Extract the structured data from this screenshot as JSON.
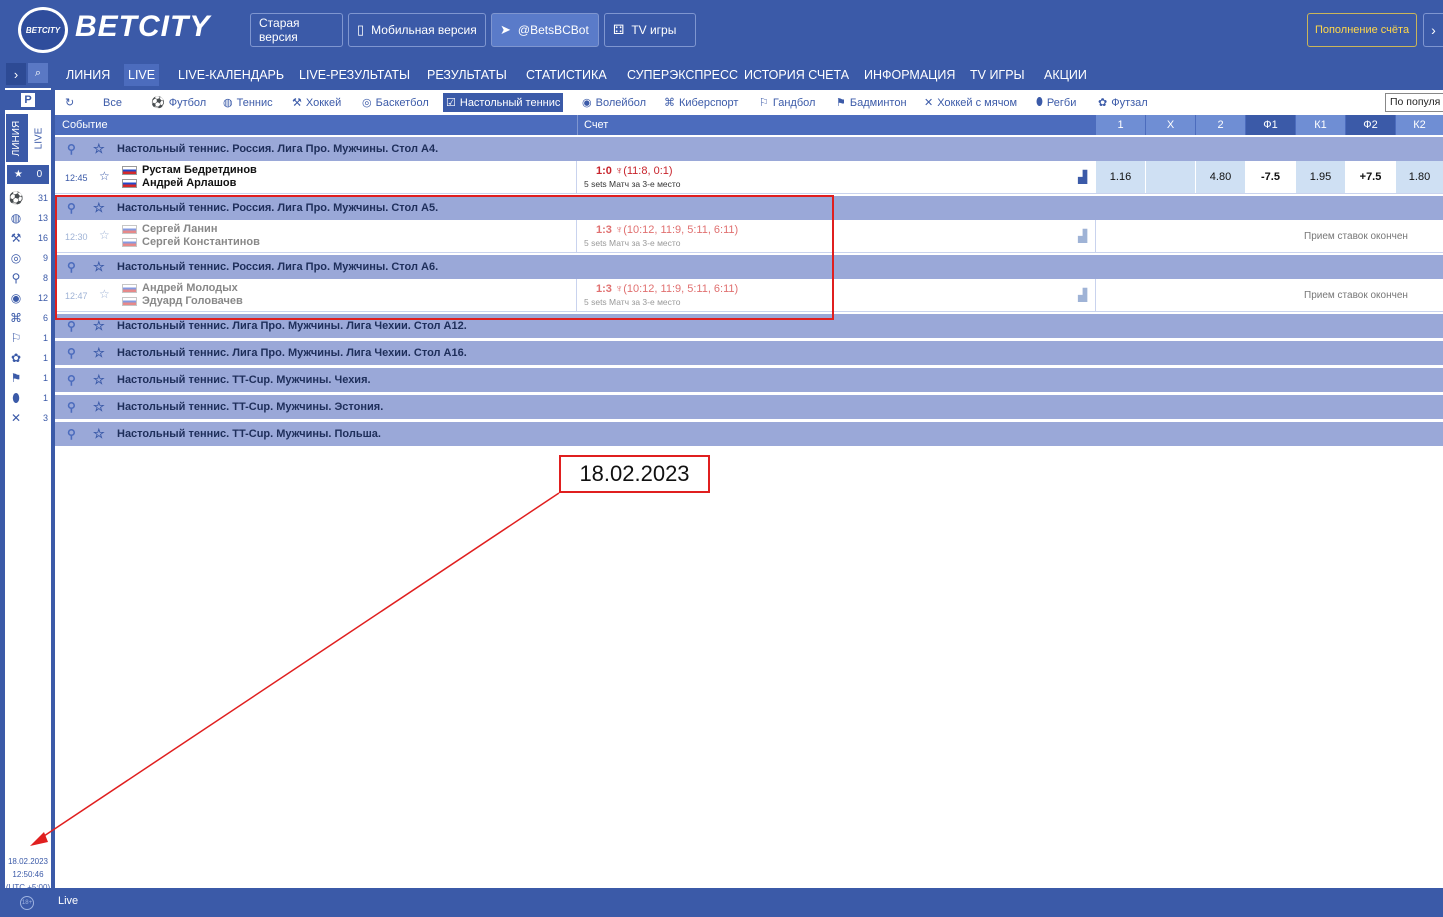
{
  "header": {
    "logo_badge": "BETCITY",
    "logo_text": "BETCITY",
    "buttons": [
      {
        "label": "Старая версия"
      },
      {
        "label": "Мобильная версия"
      },
      {
        "label": "@BetsBCBot"
      },
      {
        "label": "TV игры"
      }
    ],
    "topup_label": "Пополнение счёта",
    "topup_arrow": "›"
  },
  "nav": {
    "items": [
      {
        "label": "ЛИНИЯ"
      },
      {
        "label": "LIVE"
      },
      {
        "label": "LIVE-КАЛЕНДАРЬ"
      },
      {
        "label": "LIVE-РЕЗУЛЬТАТЫ"
      },
      {
        "label": "РЕЗУЛЬТАТЫ"
      },
      {
        "label": "СТАТИСТИКА"
      },
      {
        "label": "СУПЕРЭКСПРЕСС"
      },
      {
        "label": "ИСТОРИЯ СЧЕТА"
      },
      {
        "label": "ИНФОРМАЦИЯ"
      },
      {
        "label": "TV ИГРЫ"
      },
      {
        "label": "АКЦИИ"
      }
    ],
    "active": "LIVE"
  },
  "sidebar": {
    "park_label": "P",
    "tab_line": "ЛИНИЯ",
    "tab_live": "LIVE",
    "favorites_count": "0",
    "sports": [
      {
        "icon": "soccer-icon",
        "count": "31"
      },
      {
        "icon": "tennis-icon",
        "count": "13"
      },
      {
        "icon": "hockey-icon",
        "count": "16"
      },
      {
        "icon": "basketball-icon",
        "count": "9"
      },
      {
        "icon": "table-tennis-icon",
        "count": "8"
      },
      {
        "icon": "volleyball-icon",
        "count": "12"
      },
      {
        "icon": "esports-icon",
        "count": "6"
      },
      {
        "icon": "handball-icon",
        "count": "1"
      },
      {
        "icon": "futsal-icon",
        "count": "1"
      },
      {
        "icon": "badminton-icon",
        "count": "1"
      },
      {
        "icon": "rugby-icon",
        "count": "1"
      },
      {
        "icon": "bandy-icon",
        "count": "3"
      }
    ],
    "date": "18.02.2023",
    "time": "12:50:46",
    "tz": "(UTC +5:00)",
    "age": "18+"
  },
  "filters": {
    "tabs": [
      {
        "label": "Все",
        "icon": "refresh-icon"
      },
      {
        "label": "Футбол",
        "icon": "soccer-icon"
      },
      {
        "label": "Теннис",
        "icon": "tennis-icon"
      },
      {
        "label": "Хоккей",
        "icon": "hockey-icon"
      },
      {
        "label": "Баскетбол",
        "icon": "basketball-icon"
      },
      {
        "label": "Настольный теннис",
        "icon": "checkbox-icon"
      },
      {
        "label": "Волейбол",
        "icon": "volleyball-icon"
      },
      {
        "label": "Киберспорт",
        "icon": "esports-icon"
      },
      {
        "label": "Гандбол",
        "icon": "handball-icon"
      },
      {
        "label": "Бадминтон",
        "icon": "badminton-icon"
      },
      {
        "label": "Хоккей с мячом",
        "icon": "bandy-icon"
      },
      {
        "label": "Регби",
        "icon": "rugby-icon"
      },
      {
        "label": "Футзал",
        "icon": "futsal-icon"
      }
    ],
    "active": "Настольный теннис",
    "sort_value": "По популя"
  },
  "table": {
    "col_event": "Событие",
    "col_score": "Счет",
    "odds_cols": [
      "1",
      "X",
      "2",
      "Ф1",
      "К1",
      "Ф2",
      "К2"
    ]
  },
  "leagues": [
    "Настольный теннис. Россия. Лига Про. Мужчины. Стол А4.",
    "Настольный теннис. Россия. Лига Про. Мужчины. Стол А5.",
    "Настольный теннис. Россия. Лига Про. Мужчины. Стол А6.",
    "Настольный теннис. Лига Про. Мужчины. Лига Чехии. Стол А12.",
    "Настольный теннис. Лига Про. Мужчины. Лига Чехии. Стол А16.",
    "Настольный теннис. TT-Cup. Мужчины. Чехия.",
    "Настольный теннис. TT-Cup. Мужчины. Эстония.",
    "Настольный теннис. TT-Cup. Мужчины. Польша."
  ],
  "events": [
    {
      "time": "12:45",
      "team1": "Рустам Бедретдинов",
      "team2": "Андрей Арлашов",
      "score": "1:0",
      "sets": "(11:8, 0:1)",
      "sub": "5 sets Матч за 3-е место",
      "odds": [
        "1.16",
        "",
        "4.80",
        "-7.5",
        "1.95",
        "+7.5",
        "1.80"
      ]
    },
    {
      "time": "12:30",
      "team1": "Сергей Ланин",
      "team2": "Сергей Константинов",
      "score": "1:3",
      "sets": "(10:12, 11:9, 5:11, 6:11)",
      "sub": "5 sets Матч за 3-е место",
      "status": "Прием ставок окончен"
    },
    {
      "time": "12:47",
      "team1": "Андрей Молодых",
      "team2": "Эдуард Головачев",
      "score": "1:3",
      "sets": "(10:12, 11:9, 5:11, 6:11)",
      "sub": "5 sets Матч за 3-е место",
      "status": "Прием ставок окончен"
    }
  ],
  "annotation": {
    "date_label": "18.02.2023"
  },
  "footer": {
    "live_label": "Live"
  },
  "colors": {
    "brand": "#3b5aa8",
    "league_bg": "#9aa8d8",
    "highlight": "#e01f1f",
    "score": "#c8242c"
  }
}
